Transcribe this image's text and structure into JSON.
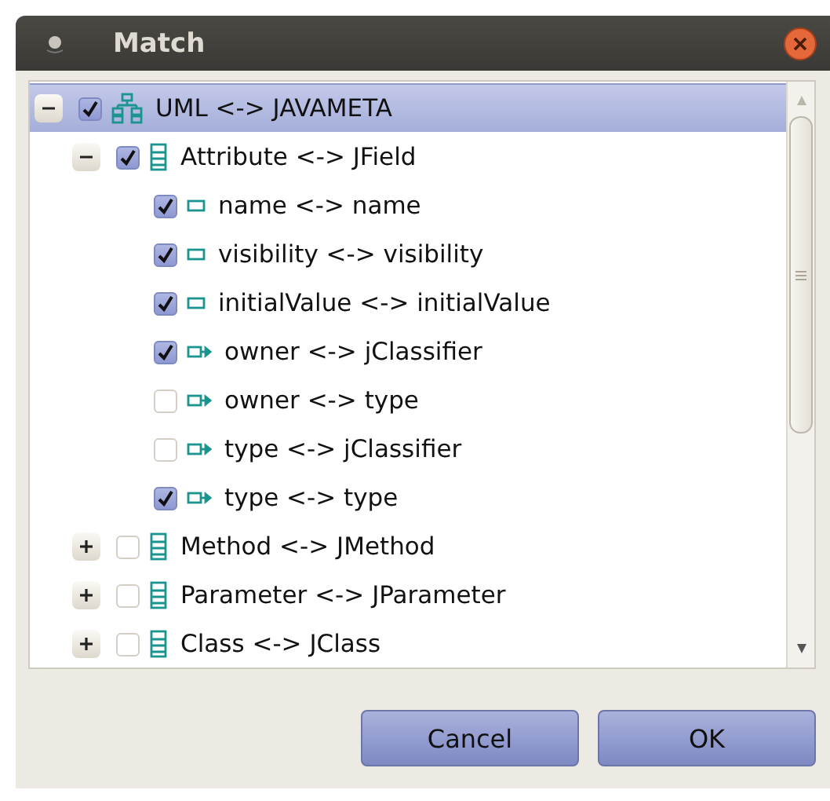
{
  "window": {
    "title": "Match"
  },
  "tree": [
    {
      "label": "UML <-> JAVAMETA",
      "kind": "package",
      "checked": true,
      "selected": true,
      "expanded": true,
      "children": [
        {
          "label": "Attribute <-> JField",
          "kind": "class",
          "checked": true,
          "selected": false,
          "expanded": true,
          "children": [
            {
              "label": "name <-> name",
              "kind": "attribute",
              "checked": true,
              "selected": false
            },
            {
              "label": "visibility <-> visibility",
              "kind": "attribute",
              "checked": true,
              "selected": false
            },
            {
              "label": "initialValue <-> initialValue",
              "kind": "attribute",
              "checked": true,
              "selected": false
            },
            {
              "label": "owner <-> jClassifier",
              "kind": "reference",
              "checked": true,
              "selected": false
            },
            {
              "label": "owner <-> type",
              "kind": "reference",
              "checked": false,
              "selected": false
            },
            {
              "label": "type <-> jClassifier",
              "kind": "reference",
              "checked": false,
              "selected": false
            },
            {
              "label": "type <-> type",
              "kind": "reference",
              "checked": true,
              "selected": false
            }
          ]
        },
        {
          "label": "Method <-> JMethod",
          "kind": "class",
          "checked": false,
          "selected": false,
          "expanded": false
        },
        {
          "label": "Parameter <-> JParameter",
          "kind": "class",
          "checked": false,
          "selected": false,
          "expanded": false
        },
        {
          "label": "Class <-> JClass",
          "kind": "class",
          "checked": false,
          "selected": false,
          "expanded": false
        }
      ]
    }
  ],
  "buttons": [
    "Cancel",
    "OK"
  ]
}
